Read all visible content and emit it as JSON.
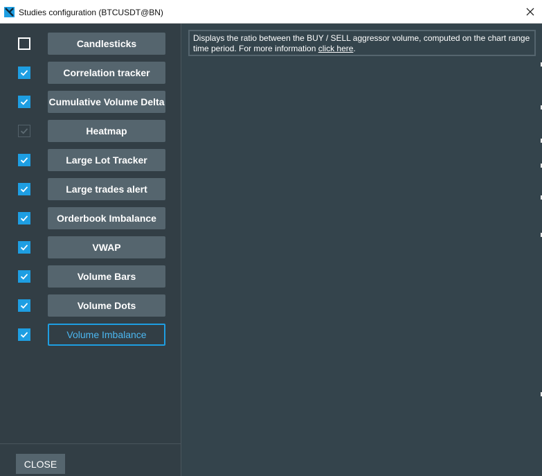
{
  "window": {
    "title": "Studies configuration (BTCUSDT@BN)"
  },
  "studies": [
    {
      "label": "Candlesticks",
      "state": "unchecked",
      "active": false
    },
    {
      "label": "Correlation tracker",
      "state": "checked",
      "active": false
    },
    {
      "label": "Cumulative Volume Delta",
      "state": "checked",
      "active": false
    },
    {
      "label": "Heatmap",
      "state": "disabled",
      "active": false
    },
    {
      "label": "Large Lot Tracker",
      "state": "checked",
      "active": false
    },
    {
      "label": "Large trades alert",
      "state": "checked",
      "active": false
    },
    {
      "label": "Orderbook Imbalance",
      "state": "checked",
      "active": false
    },
    {
      "label": "VWAP",
      "state": "checked",
      "active": false
    },
    {
      "label": "Volume Bars",
      "state": "checked",
      "active": false
    },
    {
      "label": "Volume Dots",
      "state": "checked",
      "active": false
    },
    {
      "label": "Volume Imbalance",
      "state": "checked",
      "active": true
    }
  ],
  "description": {
    "text": "Displays the ratio between the BUY / SELL aggressor volume, computed on the chart range time period. For more information ",
    "link_text": "click here",
    "trailing": "."
  },
  "footer": {
    "close_label": "CLOSE"
  },
  "colors": {
    "accent": "#1e9ee2",
    "panel": "#323e45",
    "button": "#55656e"
  }
}
